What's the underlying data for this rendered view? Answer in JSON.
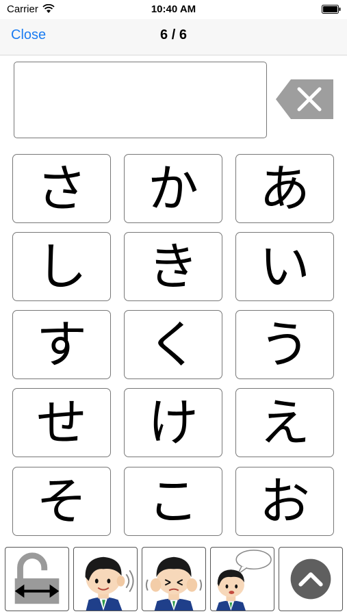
{
  "status_bar": {
    "carrier": "Carrier",
    "time": "10:40 AM"
  },
  "nav": {
    "close_label": "Close",
    "page_indicator": "6 / 6"
  },
  "input": {
    "value": ""
  },
  "keypad": {
    "rows": [
      [
        "さ",
        "か",
        "あ"
      ],
      [
        "し",
        "き",
        "い"
      ],
      [
        "す",
        "く",
        "う"
      ],
      [
        "せ",
        "け",
        "え"
      ],
      [
        "そ",
        "こ",
        "お"
      ]
    ]
  },
  "toolbar": {
    "items": [
      "lock-swap-icon",
      "person-listening-icon",
      "person-covering-ears-icon",
      "person-speaking-icon",
      "scroll-up-icon"
    ]
  },
  "colors": {
    "accent": "#1b7cf2",
    "backspace": "#9e9e9e",
    "up_button": "#5f5f5f"
  }
}
